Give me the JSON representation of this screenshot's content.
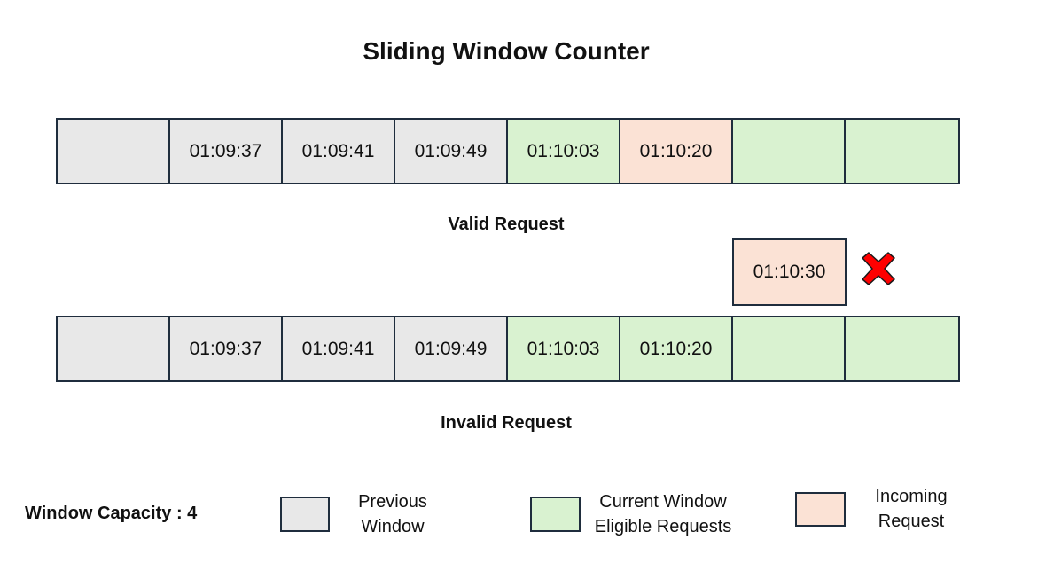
{
  "title": "Sliding Window Counter",
  "colors": {
    "previous": "#e8e8e8",
    "current": "#d9f2d0",
    "incoming": "#fbe2d5",
    "border": "#1f2d3d",
    "reject_mark": "#ff0000"
  },
  "valid_row": {
    "cells": [
      {
        "type": "previous",
        "text": ""
      },
      {
        "type": "previous",
        "text": "01:09:37"
      },
      {
        "type": "previous",
        "text": "01:09:41"
      },
      {
        "type": "previous",
        "text": "01:09:49"
      },
      {
        "type": "current",
        "text": "01:10:03"
      },
      {
        "type": "incoming",
        "text": "01:10:20"
      },
      {
        "type": "current",
        "text": ""
      },
      {
        "type": "current",
        "text": ""
      }
    ],
    "caption": "Valid Request"
  },
  "incoming_request": {
    "text": "01:10:30",
    "status_icon": "red-x-icon"
  },
  "invalid_row": {
    "cells": [
      {
        "type": "previous",
        "text": ""
      },
      {
        "type": "previous",
        "text": "01:09:37"
      },
      {
        "type": "previous",
        "text": "01:09:41"
      },
      {
        "type": "previous",
        "text": "01:09:49"
      },
      {
        "type": "current",
        "text": "01:10:03"
      },
      {
        "type": "current",
        "text": "01:10:20"
      },
      {
        "type": "current",
        "text": ""
      },
      {
        "type": "current",
        "text": ""
      }
    ],
    "caption": "Invalid Request"
  },
  "capacity_label": "Window Capacity : 4",
  "legend": {
    "previous": {
      "line1": "Previous",
      "line2": "Window"
    },
    "current": {
      "line1": "Current Window",
      "line2": "Eligible Requests"
    },
    "incoming": {
      "line1": "Incoming",
      "line2": "Request"
    }
  }
}
